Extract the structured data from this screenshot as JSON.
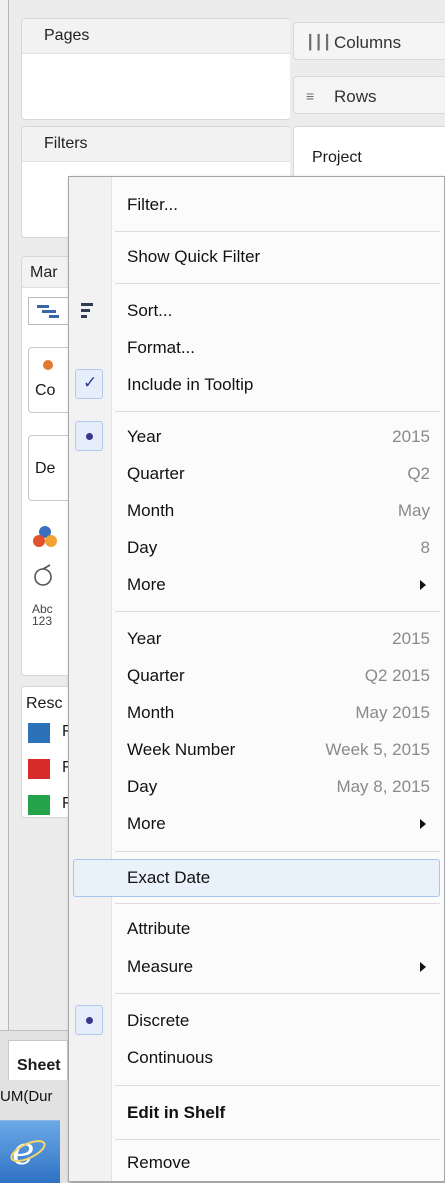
{
  "left_pane": {
    "pages_title": "Pages",
    "filters_title": "Filters",
    "marks_title_partial": "Mar",
    "marks_color_partial": "Co",
    "marks_detail_partial": "De",
    "abc_label": "Abc\n123",
    "legend_title_partial": "Resc",
    "legend_colors": [
      "#2b72b8",
      "#d72b2b",
      "#24a34a"
    ],
    "legend_items_partial": [
      "F",
      "F",
      "F"
    ]
  },
  "right_pane": {
    "columns_label": "Columns",
    "rows_label": "Rows",
    "project_label": "Project"
  },
  "bottom": {
    "sheet_tab_partial": "Sheet",
    "status_partial": "UM(Dur"
  },
  "context_menu": {
    "items": [
      {
        "label": "Filter..."
      },
      {
        "label": "Show Quick Filter"
      },
      {
        "label": "Sort..."
      },
      {
        "label": "Format..."
      },
      {
        "label": "Include in Tooltip",
        "checked": true
      },
      {
        "label": "Year",
        "value": "2015",
        "selected": true
      },
      {
        "label": "Quarter",
        "value": "Q2"
      },
      {
        "label": "Month",
        "value": "May"
      },
      {
        "label": "Day",
        "value": "8"
      },
      {
        "label": "More",
        "submenu": true
      },
      {
        "label": "Year",
        "value": "2015"
      },
      {
        "label": "Quarter",
        "value": "Q2 2015"
      },
      {
        "label": "Month",
        "value": "May 2015"
      },
      {
        "label": "Week Number",
        "value": "Week 5, 2015"
      },
      {
        "label": "Day",
        "value": "May 8, 2015"
      },
      {
        "label": "More",
        "submenu": true
      },
      {
        "label": "Exact Date",
        "highlighted": true
      },
      {
        "label": "Attribute"
      },
      {
        "label": "Measure",
        "submenu": true
      },
      {
        "label": "Discrete",
        "selected": true
      },
      {
        "label": "Continuous"
      },
      {
        "label": "Edit in Shelf",
        "bold": true
      },
      {
        "label": "Remove"
      }
    ]
  }
}
